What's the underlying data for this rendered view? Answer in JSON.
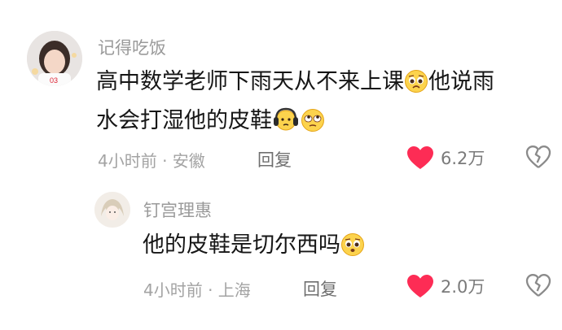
{
  "comments": [
    {
      "username": "记得吃饭",
      "text_part1": "高中数学老师下雨天从不来上课",
      "text_part2": "他说雨",
      "text_line2": "水会打湿他的皮鞋",
      "meta": "4小时前 · 安徽",
      "reply_label": "回复",
      "likes": "6.2万",
      "icons": [
        "pleading-face-icon",
        "headphones-face-icon",
        "rolling-eyes-face-icon",
        "heart-icon",
        "broken-heart-icon"
      ]
    }
  ],
  "replies": [
    {
      "username": "钉宫理惠",
      "text": "他的皮鞋是切尔西吗",
      "meta": "4小时前 · 上海",
      "reply_label": "回复",
      "likes": "2.0万",
      "icons": [
        "pleading-face-icon",
        "heart-icon",
        "broken-heart-icon"
      ]
    }
  ],
  "colors": {
    "heart": "#fd2c55",
    "username": "#9a9a9a",
    "text": "#161616",
    "meta": "#a3a3a3"
  }
}
